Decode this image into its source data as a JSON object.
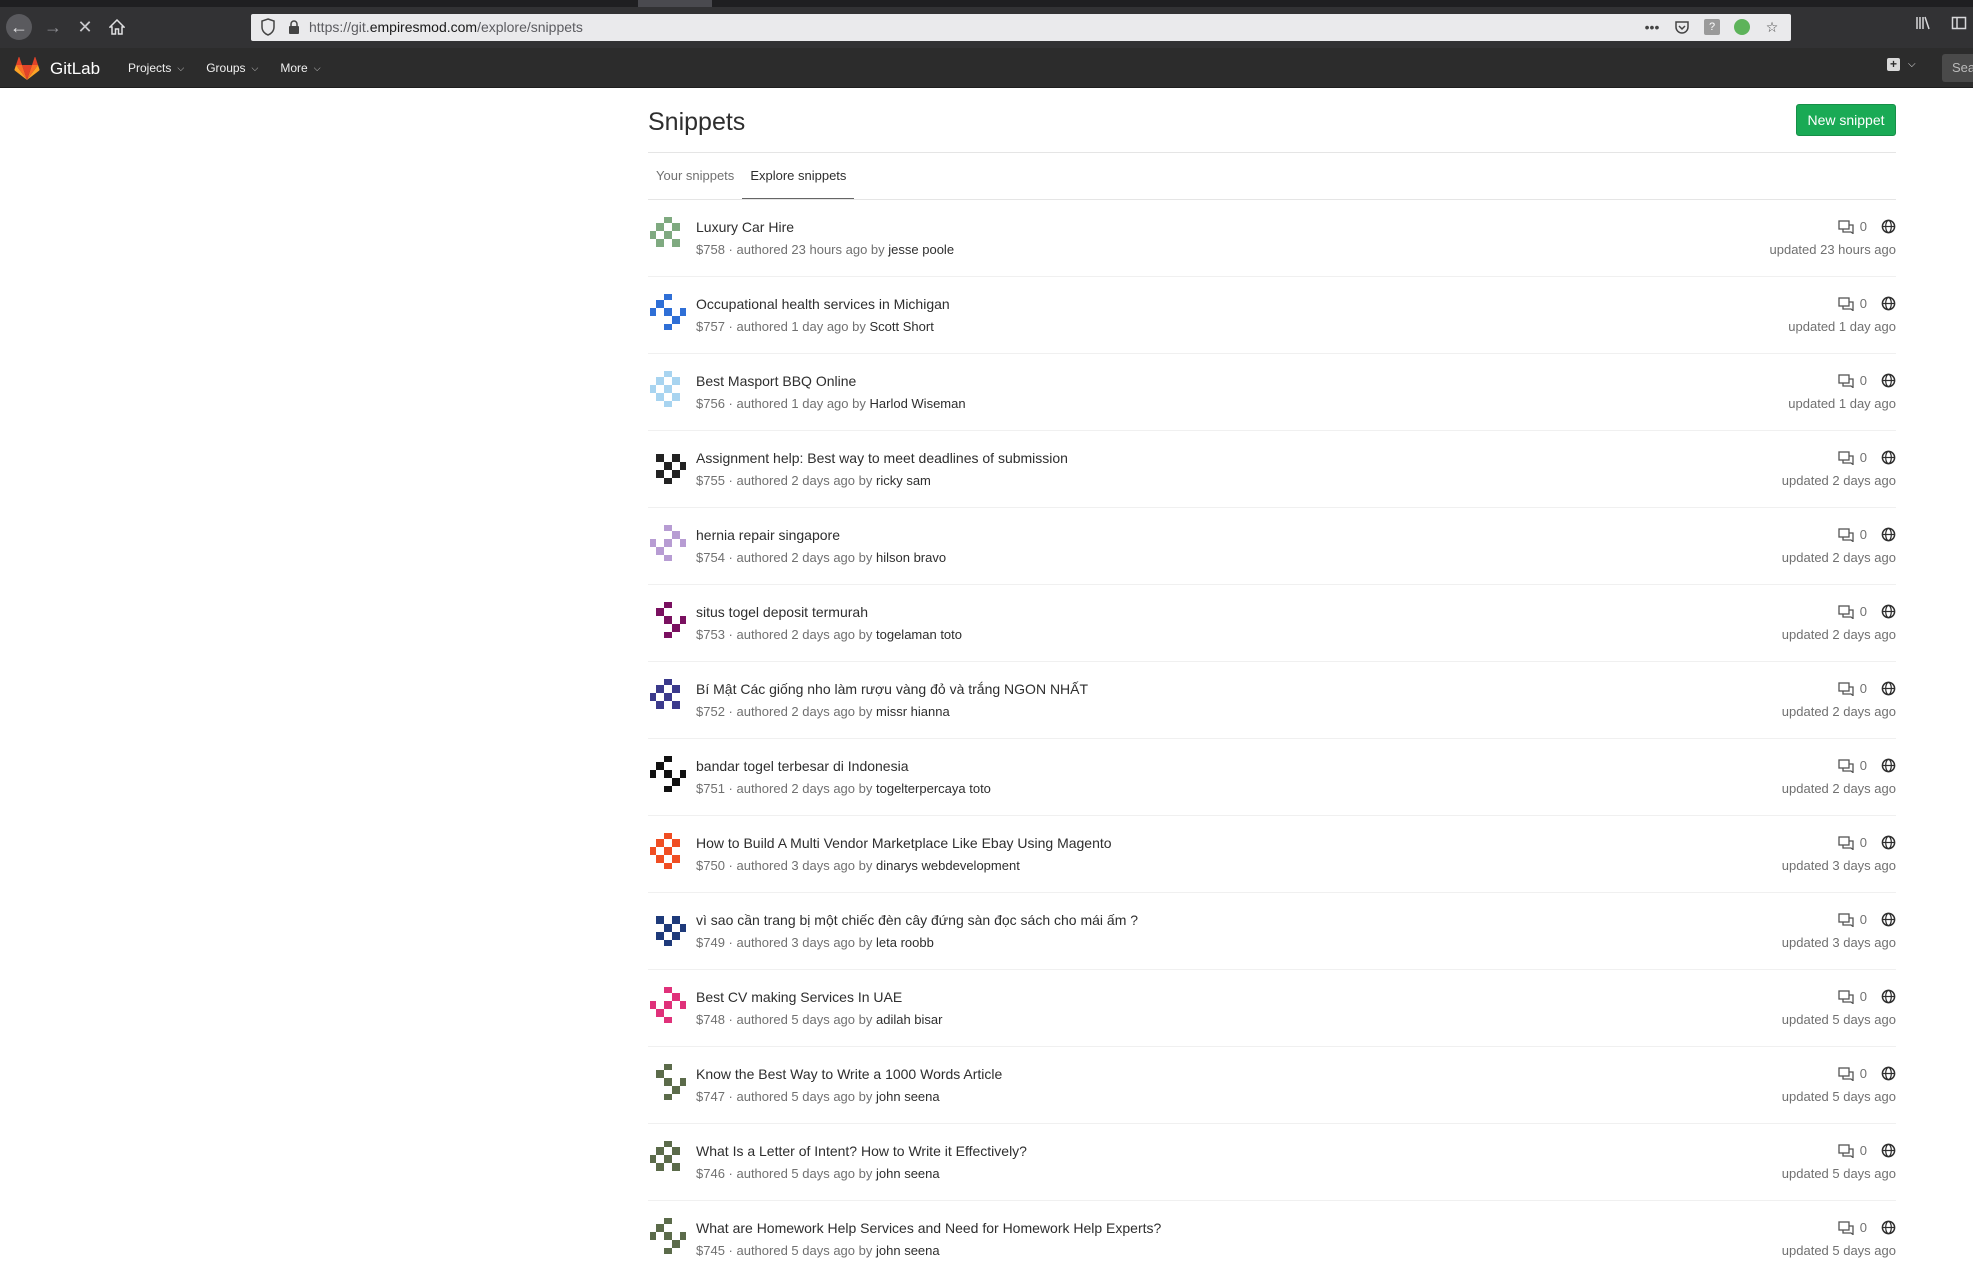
{
  "browser": {
    "url_prefix": "https://git.",
    "url_domain": "empiresmod.com",
    "url_path": "/explore/snippets"
  },
  "header": {
    "brand": "GitLab",
    "menu": [
      {
        "label": "Projects"
      },
      {
        "label": "Groups"
      },
      {
        "label": "More"
      }
    ],
    "search_placeholder": "Sea"
  },
  "page": {
    "title": "Snippets",
    "new_button": "New snippet",
    "tabs": [
      {
        "label": "Your snippets",
        "active": false
      },
      {
        "label": "Explore snippets",
        "active": true
      }
    ]
  },
  "snippets": [
    {
      "title": "Luxury Car Hire",
      "ref": "$758",
      "authored": "authored 23 hours ago by",
      "author": "jesse poole",
      "comments": "0",
      "updated": "updated 23 hours ago",
      "avatar_color": "#7faa80"
    },
    {
      "title": "Occupational health services in Michigan",
      "ref": "$757",
      "authored": "authored 1 day ago by",
      "author": "Scott Short",
      "comments": "0",
      "updated": "updated 1 day ago",
      "avatar_color": "#2f6fd6"
    },
    {
      "title": "Best Masport BBQ Online",
      "ref": "$756",
      "authored": "authored 1 day ago by",
      "author": "Harlod Wiseman",
      "comments": "0",
      "updated": "updated 1 day ago",
      "avatar_color": "#a8d4f0"
    },
    {
      "title": "Assignment help: Best way to meet deadlines of submission",
      "ref": "$755",
      "authored": "authored 2 days ago by",
      "author": "ricky sam",
      "comments": "0",
      "updated": "updated 2 days ago",
      "avatar_color": "#222222"
    },
    {
      "title": "hernia repair singapore",
      "ref": "$754",
      "authored": "authored 2 days ago by",
      "author": "hilson bravo",
      "comments": "0",
      "updated": "updated 2 days ago",
      "avatar_color": "#b79cd3"
    },
    {
      "title": "situs togel deposit termurah",
      "ref": "$753",
      "authored": "authored 2 days ago by",
      "author": "togelaman toto",
      "comments": "0",
      "updated": "updated 2 days ago",
      "avatar_color": "#7a1060"
    },
    {
      "title": "Bí Mật Các giống nho làm rượu vàng đỏ và trắng NGON NHẤT",
      "ref": "$752",
      "authored": "authored 2 days ago by",
      "author": "missr hianna",
      "comments": "0",
      "updated": "updated 2 days ago",
      "avatar_color": "#3b3a8c"
    },
    {
      "title": "bandar togel terbesar di Indonesia",
      "ref": "$751",
      "authored": "authored 2 days ago by",
      "author": "togelterpercaya toto",
      "comments": "0",
      "updated": "updated 2 days ago",
      "avatar_color": "#111111"
    },
    {
      "title": "How to Build A Multi Vendor Marketplace Like Ebay Using Magento",
      "ref": "$750",
      "authored": "authored 3 days ago by",
      "author": "dinarys webdevelopment",
      "comments": "0",
      "updated": "updated 3 days ago",
      "avatar_color": "#f04e23"
    },
    {
      "title": "vì sao cần trang bị một chiếc đèn cây đứng sàn đọc sách cho mái ấm ?",
      "ref": "$749",
      "authored": "authored 3 days ago by",
      "author": "leta roobb",
      "comments": "0",
      "updated": "updated 3 days ago",
      "avatar_color": "#1e3a7a"
    },
    {
      "title": "Best CV making Services In UAE",
      "ref": "$748",
      "authored": "authored 5 days ago by",
      "author": "adilah bisar",
      "comments": "0",
      "updated": "updated 5 days ago",
      "avatar_color": "#e0317a"
    },
    {
      "title": "Know the Best Way to Write a 1000 Words Article",
      "ref": "$747",
      "authored": "authored 5 days ago by",
      "author": "john seena",
      "comments": "0",
      "updated": "updated 5 days ago",
      "avatar_color": "#5b6b4a"
    },
    {
      "title": "What Is a Letter of Intent? How to Write it Effectively?",
      "ref": "$746",
      "authored": "authored 5 days ago by",
      "author": "john seena",
      "comments": "0",
      "updated": "updated 5 days ago",
      "avatar_color": "#5b6b4a"
    },
    {
      "title": "What are Homework Help Services and Need for Homework Help Experts?",
      "ref": "$745",
      "authored": "authored 5 days ago by",
      "author": "john seena",
      "comments": "0",
      "updated": "updated 5 days ago",
      "avatar_color": "#5b6b4a"
    }
  ]
}
